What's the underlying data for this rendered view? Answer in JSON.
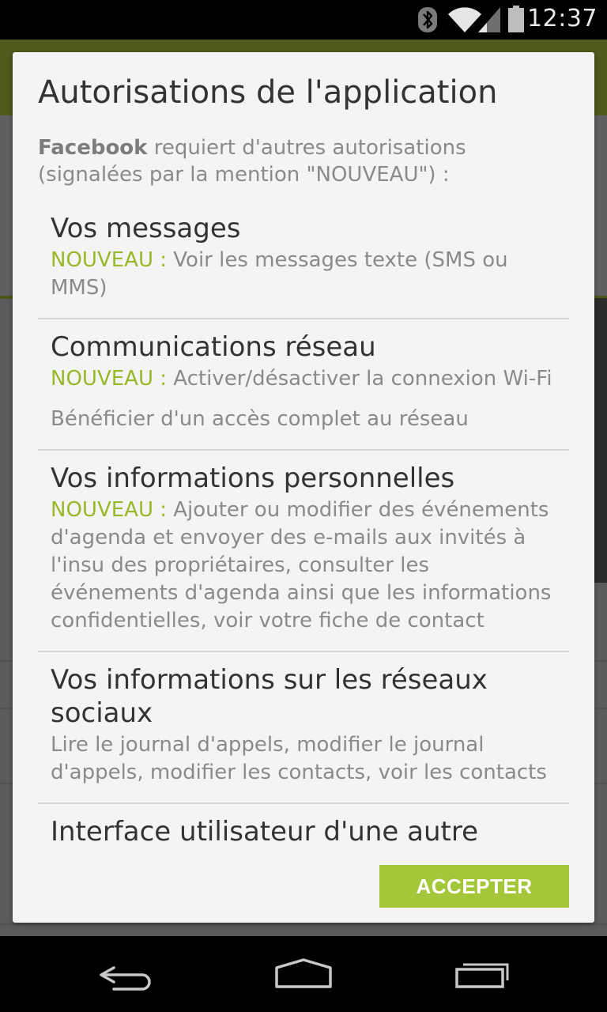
{
  "status_bar": {
    "time": "12:37",
    "icons": [
      "bluetooth-icon",
      "wifi-icon",
      "cell-signal-icon",
      "battery-icon"
    ],
    "background": "#000000"
  },
  "dialog": {
    "title": "Autorisations de l'application",
    "intro": {
      "app_name": "Facebook",
      "text": " requiert d'autres autorisations (signalées par la mention \"NOUVEAU\") :"
    },
    "new_tag_color": "#99b828",
    "accent_color": "#a4c639",
    "sections": [
      {
        "title": "Vos messages",
        "lines": [
          {
            "tag": "NOUVEAU : ",
            "text": "Voir les messages texte (SMS ou MMS)"
          }
        ]
      },
      {
        "title": "Communications réseau",
        "lines": [
          {
            "tag": "NOUVEAU : ",
            "text": "Activer/désactiver la connexion Wi-Fi"
          },
          {
            "text": "Bénéficier d'un accès complet au réseau"
          }
        ]
      },
      {
        "title": "Vos informations personnelles",
        "lines": [
          {
            "tag": "NOUVEAU : ",
            "text": "Ajouter ou modifier des événements d'agenda et envoyer des e-mails aux invités à l'insu des propriétaires, consulter les événements d'agenda ainsi que les informations confidentielles, voir votre fiche de contact"
          }
        ]
      },
      {
        "title": "Vos informations sur les réseaux sociaux",
        "lines": [
          {
            "text": "Lire le journal d'appels, modifier le journal d'appels, modifier les contacts, voir les contacts"
          }
        ]
      },
      {
        "title": "Interface utilisateur d'une autre application",
        "lines": []
      }
    ],
    "accept_label": "ACCEPTER"
  },
  "nav_bar": {
    "buttons": [
      "back-icon",
      "home-icon",
      "recent-apps-icon"
    ]
  }
}
